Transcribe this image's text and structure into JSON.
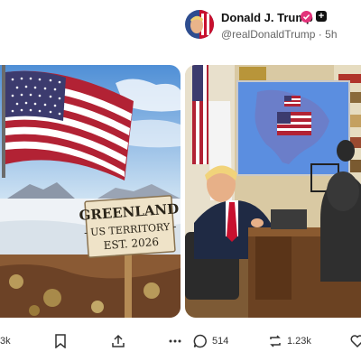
{
  "post": {
    "display_name": "Donald J. Trump",
    "handle": "@realDonaldTrump",
    "separator": "·",
    "time_ago": "5h",
    "verified_badge_color": "#e2327a",
    "extra_badge_symbol": "+"
  },
  "media": {
    "left_sign": {
      "line1": "GREENLAND",
      "line2": "- US TERRITORY -",
      "line3": "EST. 2026"
    }
  },
  "actions": {
    "left_partial_count": "3k",
    "reply_count": "514",
    "repost_count": "1.23k"
  },
  "icons": [
    "avatar",
    "verified-icon",
    "plus-badge-icon",
    "bookmark-icon",
    "share-icon",
    "more-icon",
    "reply-icon",
    "repost-icon",
    "heart-icon"
  ]
}
